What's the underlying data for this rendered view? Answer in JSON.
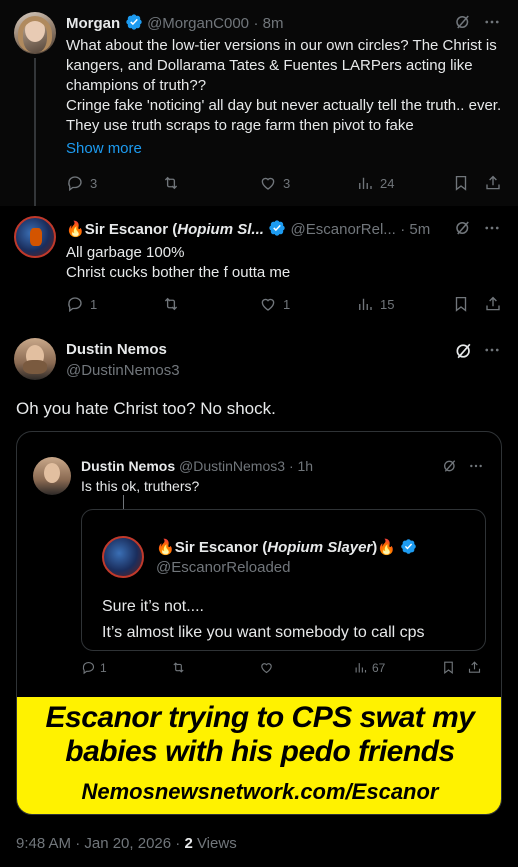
{
  "colors": {
    "background": "#000000",
    "text": "#e7e9ea",
    "muted": "#71767b",
    "link": "#1d9bf0",
    "verified": "#1d9bf0",
    "banner_yellow": "#fff200"
  },
  "tweet1": {
    "name": "Morgan",
    "handle": "@MorganC000",
    "time": "· 8m",
    "text": "What about the low-tier versions in our own circles? The Christ is kangers, and Dollarama Tates & Fuentes LARPers acting like champions of truth??\nCringe fake 'noticing' all day but never actually tell the truth.. ever. They use truth scraps to rage farm then pivot to fake",
    "show_more": "Show more",
    "replies": "3",
    "retweets": "",
    "likes": "3",
    "views": "24"
  },
  "tweet2": {
    "name_emoji": "🔥",
    "name_prefix": "Sir Escanor (",
    "name_italic": "Hopium Sl...",
    "handle": "@EscanorRel...",
    "time": "· 5m",
    "line1": "All garbage 100%",
    "line2": "Christ cucks bother the f outta me",
    "replies": "1",
    "retweets": "",
    "likes": "1",
    "views": "15"
  },
  "tweet3": {
    "name": "Dustin Nemos",
    "handle": "@DustinNemos3",
    "text": "Oh you hate Christ too? No shock.",
    "timestamp": "9:48 AM · Jan 20, 2026 · ",
    "views_count": "2",
    "views_label": " Views"
  },
  "quoted": {
    "name": "Dustin Nemos",
    "handle": "@DustinNemos3",
    "time": "· 1h",
    "text": "Is this ok, truthers?",
    "inner": {
      "name_prefix": "Sir Escanor (",
      "name_italic": "Hopium Slayer",
      "name_suffix": ")",
      "handle": "@EscanorReloaded",
      "line1": "Sure it’s not....",
      "line2": "It’s almost like you want somebody to call cps"
    },
    "replies": "1",
    "views": "67",
    "banner_line1": "Escanor trying to CPS swat my",
    "banner_line2": "babies with his pedo friends",
    "banner_url": "Nemosnewsnetwork.com/Escanor"
  }
}
